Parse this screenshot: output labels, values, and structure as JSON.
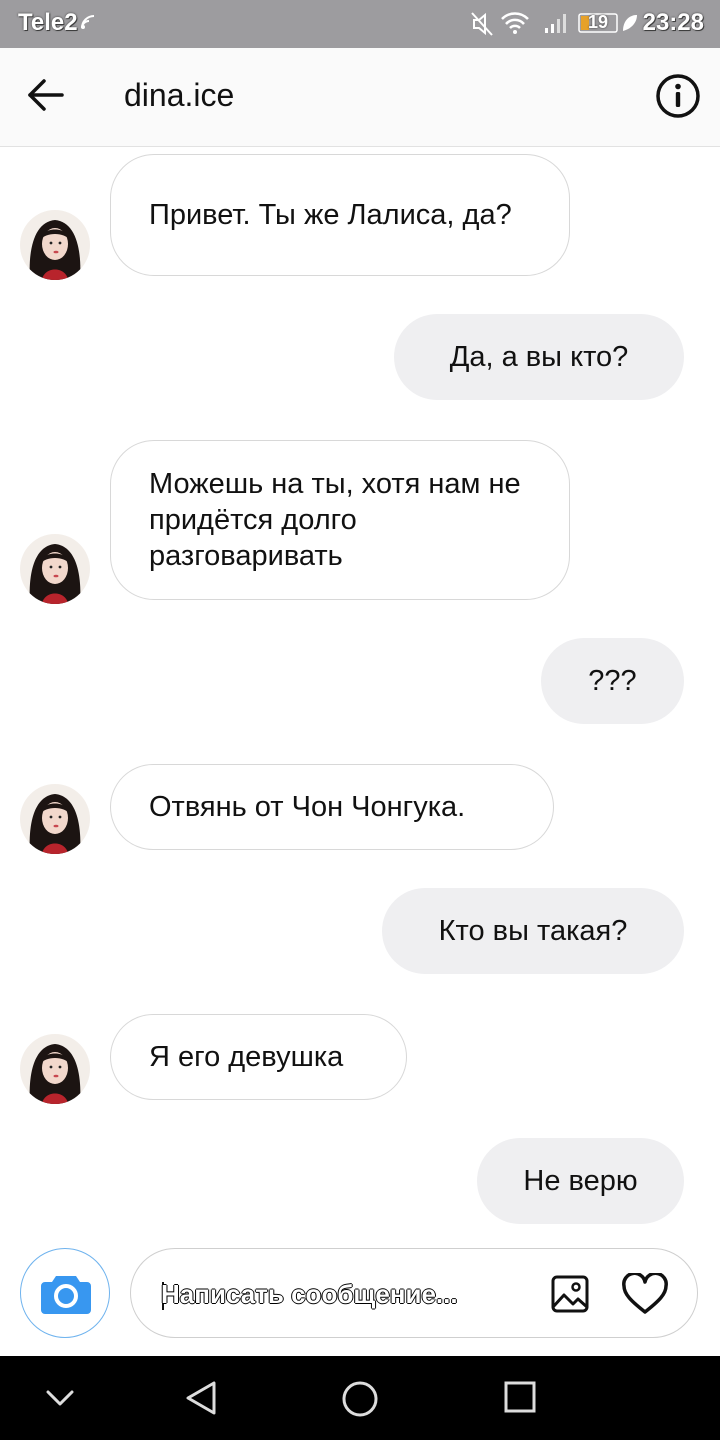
{
  "status_bar": {
    "carrier": "Tele2",
    "battery_level": "19",
    "time": "23:28",
    "icons": [
      "mute-icon",
      "wifi-icon",
      "signal-icon",
      "battery-icon",
      "leaf-icon"
    ]
  },
  "header": {
    "username": "dina.ice",
    "icons": [
      "back-arrow-icon",
      "info-icon"
    ]
  },
  "messages": [
    {
      "from": "them",
      "text": "Привет. Ты же Лалиса, да?"
    },
    {
      "from": "me",
      "text": "Да, а вы кто?"
    },
    {
      "from": "them",
      "text": "Можешь на ты, хотя нам не придётся долго разговаривать"
    },
    {
      "from": "me",
      "text": "???"
    },
    {
      "from": "them",
      "text": "Отвянь от Чон Чонгука."
    },
    {
      "from": "me",
      "text": "Кто вы такая?"
    },
    {
      "from": "them",
      "text": "Я его девушка"
    },
    {
      "from": "me",
      "text": "Не верю"
    }
  ],
  "composer": {
    "placeholder": "Написать сообщение...",
    "icons": [
      "camera-icon",
      "gallery-icon",
      "heart-icon"
    ]
  },
  "navbar": {
    "icons": [
      "chevron-down-icon",
      "back-triangle-icon",
      "home-circle-icon",
      "recents-square-icon"
    ]
  },
  "colors": {
    "status_bar_bg": "#9d9c9f",
    "outgoing_bubble": "#efeff1",
    "accent_blue": "#3897f0"
  }
}
